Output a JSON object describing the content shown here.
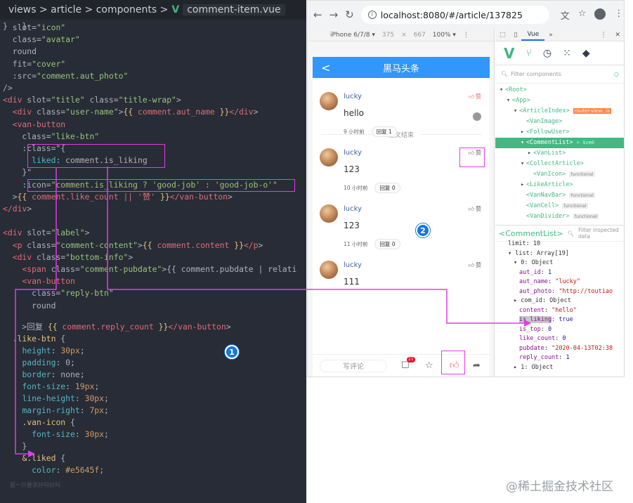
{
  "editor": {
    "breadcrumb": "views > article > components >",
    "vue_logo": "V",
    "file_name": "comment-item.vue",
    "hint": "面一只要求好吗好吗",
    "lines": [
      "  slot=\"icon\"",
      "  class=\"avatar\"",
      "  round",
      "  fit=\"cover\"",
      "  :src=\"comment.aut_photo\"",
      "/>",
      "<div slot=\"title\" class=\"title-wrap\">",
      "  <div class=\"user-name\">{{ comment.aut_name }}</div>",
      "  <van-button",
      "    class=\"like-btn\"",
      "    :class=\"{",
      "      liked: comment.is_liking",
      "    }\"",
      "    :icon=\"comment.is_liking ? 'good-job' : 'good-job-o'\"",
      "  >{{ comment.like_count || '赞' }}</van-button>",
      "</div>",
      "",
      "<div slot=\"label\">",
      "  <p class=\"comment-content\">{{ comment.content }}</p>",
      "  <div class=\"bottom-info\">",
      "    <span class=\"comment-pubdate\">{{ comment.pubdate | relati",
      "    <van-button",
      "      class=\"reply-btn\"",
      "      round",
      "    >回复 {{ comment.reply_count }}</van-button>",
      "  .like-btn {",
      "    height: 30px;",
      "    padding: 0;",
      "    border: none;",
      "    font-size: 19px;",
      "    line-height: 30px;",
      "    margin-right: 7px;",
      "    .van-icon {",
      "      font-size: 30px;",
      "    }",
      "    &.liked {",
      "      color: #e5645f;",
      "    }",
      "}"
    ]
  },
  "browser": {
    "url": "localhost:8080/#/article/137825",
    "device": "iPhone 6/7/8 ▾",
    "width": "375",
    "times": "×",
    "height": "667",
    "zoom": "100% ▾",
    "nav_back": "←",
    "nav_forward": "→",
    "nav_reload": "↻"
  },
  "phone": {
    "title": "黑马头条",
    "back": "<",
    "end_text": "正文结束",
    "like_label": "赞",
    "write_comment": "写评论",
    "comment_badge": "21",
    "comments": [
      {
        "name": "lucky",
        "content": "hello",
        "time": "9 小时前",
        "reply": "回复 1",
        "liked": true
      },
      {
        "name": "lucky",
        "content": "123",
        "time": "10 小时前",
        "reply": "回复 0",
        "liked": false
      },
      {
        "name": "lucky",
        "content": "123",
        "time": "11 小时前",
        "reply": "回复 0",
        "liked": false
      },
      {
        "name": "lucky",
        "content": "111",
        "time": "",
        "reply": "",
        "liked": false
      }
    ]
  },
  "devtools": {
    "tab_vue": "Vue",
    "tab_more": "»",
    "filter_placeholder": "Filter components",
    "inspect_title": "<CommentList>",
    "inspect_filter": "Filter inspected data",
    "tree": [
      {
        "indent": 0,
        "arrow": "▾",
        "text": "<Root>"
      },
      {
        "indent": 1,
        "arrow": "▾",
        "text": "<App>"
      },
      {
        "indent": 2,
        "arrow": "▾",
        "text": "<ArticleIndex>",
        "route": "router-view: /a"
      },
      {
        "indent": 3,
        "arrow": "",
        "text": "<VanImage>"
      },
      {
        "indent": 3,
        "arrow": "▸",
        "text": "<FollowUser>"
      },
      {
        "indent": 3,
        "arrow": "▾",
        "text": "<CommentList>",
        "vm": "= $vm0",
        "selected": true
      },
      {
        "indent": 4,
        "arrow": "▸",
        "text": "<VanList>"
      },
      {
        "indent": 3,
        "arrow": "▾",
        "text": "<CollectArticle>"
      },
      {
        "indent": 4,
        "arrow": "",
        "text": "<VanIcon>",
        "fn": "functional"
      },
      {
        "indent": 3,
        "arrow": "▸",
        "text": "<LikeArticle>"
      },
      {
        "indent": 3,
        "arrow": "",
        "text": "<VanNavBar>",
        "fn": "functional"
      },
      {
        "indent": 3,
        "arrow": "",
        "text": "<VanCell>",
        "fn": "functional"
      },
      {
        "indent": 3,
        "arrow": "",
        "text": "<VanDivider>",
        "fn": "functional"
      }
    ],
    "props": [
      {
        "indent": 1,
        "text": "limit: 10"
      },
      {
        "indent": 1,
        "text": "▾ list: Array[19]"
      },
      {
        "indent": 2,
        "text": "▾ 0: Object"
      },
      {
        "indent": 3,
        "key": "aut_id",
        "val": "1"
      },
      {
        "indent": 3,
        "key": "aut_name",
        "val": "\"lucky\"",
        "str": true
      },
      {
        "indent": 3,
        "key": "aut_photo",
        "val": "\"http://toutiao",
        "str": true
      },
      {
        "indent": 2,
        "text": "▸ com_id: Object"
      },
      {
        "indent": 3,
        "key": "content",
        "val": "\"hello\"",
        "str": true
      },
      {
        "indent": 3,
        "key": "is_liking",
        "val": "true",
        "hl": true
      },
      {
        "indent": 3,
        "key": "is_top",
        "val": "0"
      },
      {
        "indent": 3,
        "key": "like_count",
        "val": "0"
      },
      {
        "indent": 3,
        "key": "pubdate",
        "val": "\"2020-04-13T02:38",
        "str": true
      },
      {
        "indent": 3,
        "key": "reply_count",
        "val": "1"
      },
      {
        "indent": 2,
        "text": "▸ 1: Object"
      }
    ]
  },
  "annotations": {
    "marker_1": "1",
    "marker_2": "2"
  },
  "watermark": "@稀土掘金技术社区",
  "colors": {
    "accent": "#3296fa",
    "liked": "#e5645f",
    "vue_green": "#42b983",
    "annotation": "#e63ae6"
  }
}
